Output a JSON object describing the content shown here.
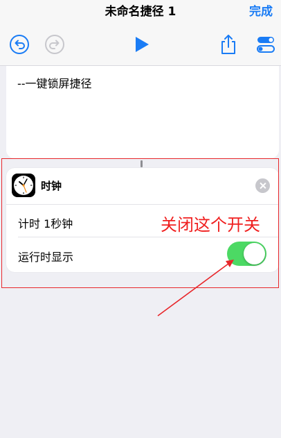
{
  "nav": {
    "title": "未命名捷径 1",
    "done_label": "完成"
  },
  "toolbar": {
    "undo_icon": "undo-icon",
    "redo_icon": "redo-icon",
    "play_icon": "play-icon",
    "share_icon": "share-icon",
    "settings_icon": "toggle-settings-icon"
  },
  "editor": {
    "comment_text": "--一键锁屏捷径"
  },
  "action": {
    "app_icon": "clock-app-icon",
    "title": "时钟",
    "params": [
      {
        "label": "计时 1秒钟"
      },
      {
        "label": "运行时显示",
        "toggle_on": true
      }
    ]
  },
  "annotation": {
    "text": "关闭这个开关",
    "color": "#f01f1f"
  },
  "colors": {
    "accent": "#1a7cf5",
    "toggle_on": "#4cd964",
    "background": "#efeff4"
  }
}
